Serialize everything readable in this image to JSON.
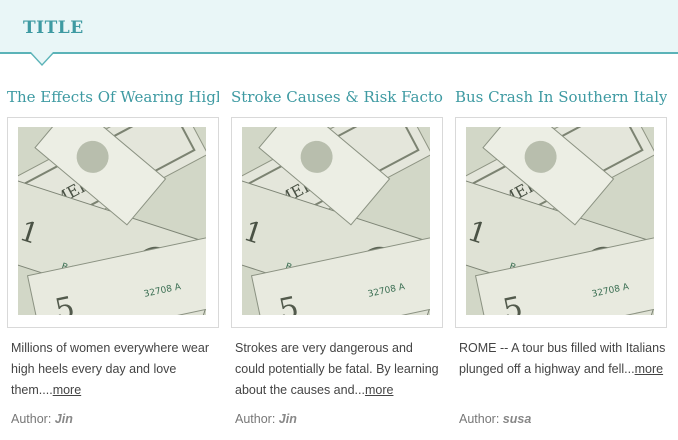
{
  "header": {
    "title": "TITLE"
  },
  "cards": [
    {
      "title": "The Effects Of Wearing High",
      "excerpt": "Millions of women everywhere wear high heels every day and love them....",
      "more": "more",
      "author_label": "Author:",
      "author_name": "Jin",
      "image": "dollar-bills-image"
    },
    {
      "title": "Stroke Causes & Risk Factor",
      "excerpt": "Strokes are very dangerous and could potentially be fatal. By learning about the causes and...",
      "more": "more",
      "author_label": "Author:",
      "author_name": "Jin",
      "image": "dollar-bills-image"
    },
    {
      "title": "Bus Crash In Southern Italy",
      "excerpt": "ROME -- A tour bus filled with Italians plunged off a highway and fell...",
      "more": "more",
      "author_label": "Author:",
      "author_name": "susa",
      "image": "dollar-bills-image"
    }
  ]
}
